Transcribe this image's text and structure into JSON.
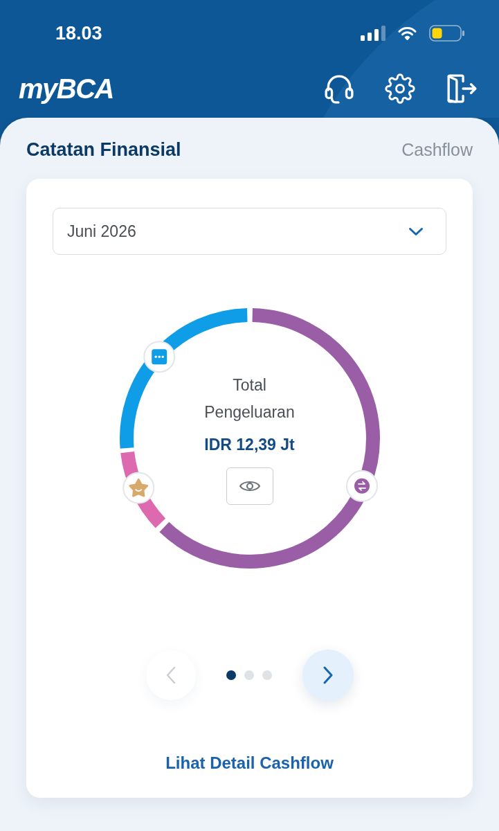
{
  "status_bar": {
    "time": "18.03"
  },
  "header": {
    "logo": "myBCA"
  },
  "section": {
    "title": "Catatan Finansial",
    "link": "Cashflow"
  },
  "card": {
    "month_select": {
      "value": "Juni 2026"
    },
    "donut": {
      "segments": [
        {
          "color": "#9a5ea6"
        },
        {
          "color": "#dd6aae"
        },
        {
          "color": "#0f9de8"
        }
      ]
    },
    "center": {
      "label": "Total Pengeluaran",
      "amount": "IDR 12,39 Jt"
    },
    "pager": {
      "prev": {
        "disabled": true
      },
      "next": {
        "disabled": false
      },
      "dots": [
        {
          "selected": true
        },
        {
          "selected": false
        },
        {
          "selected": false
        }
      ]
    },
    "detail_link": "Lihat Detail Cashflow"
  }
}
